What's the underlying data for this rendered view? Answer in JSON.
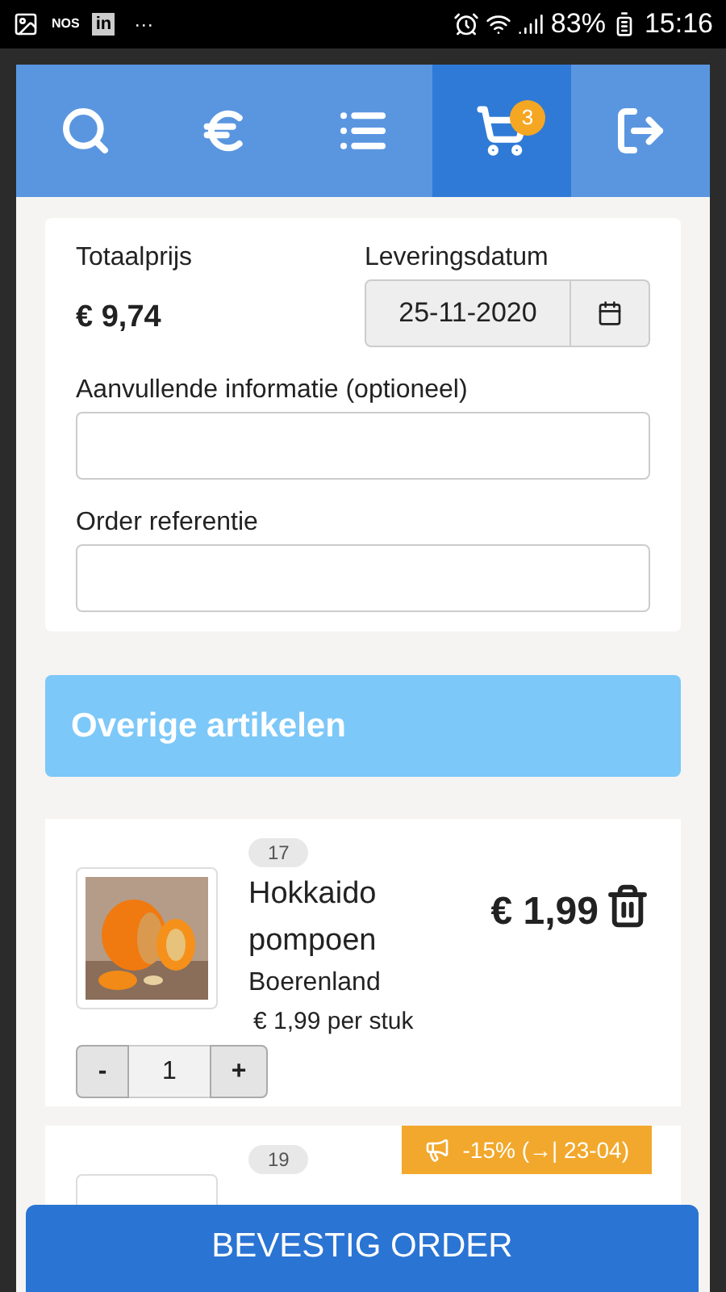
{
  "status_bar": {
    "notifications": [
      "NOS",
      "in",
      "···"
    ],
    "battery": "83%",
    "time": "15:16"
  },
  "nav": {
    "tabs": [
      {
        "kind": "search",
        "selected": false
      },
      {
        "kind": "euro",
        "selected": false
      },
      {
        "kind": "list",
        "selected": false
      },
      {
        "kind": "cart",
        "selected": true,
        "badge": "3"
      },
      {
        "kind": "logout",
        "selected": false
      }
    ]
  },
  "order": {
    "total_label": "Totaalprijs",
    "total": "€ 9,74",
    "date_label": "Leveringsdatum",
    "date": "25-11-2020",
    "info_label": "Aanvullende informatie (optioneel)",
    "reference_label": "Order referentie"
  },
  "section_title": "Overige artikelen",
  "items": [
    {
      "number": "17",
      "name": "Hokkaido pompoen",
      "supplier": "Boerenland",
      "unit_price": "€ 1,99 per stuk",
      "price": "€ 1,99",
      "quantity": "1",
      "minus": "-",
      "plus": "+"
    },
    {
      "number": "19",
      "promo": "-15% (→| 23-04)"
    }
  ],
  "confirm_button": "BEVESTIG ORDER"
}
